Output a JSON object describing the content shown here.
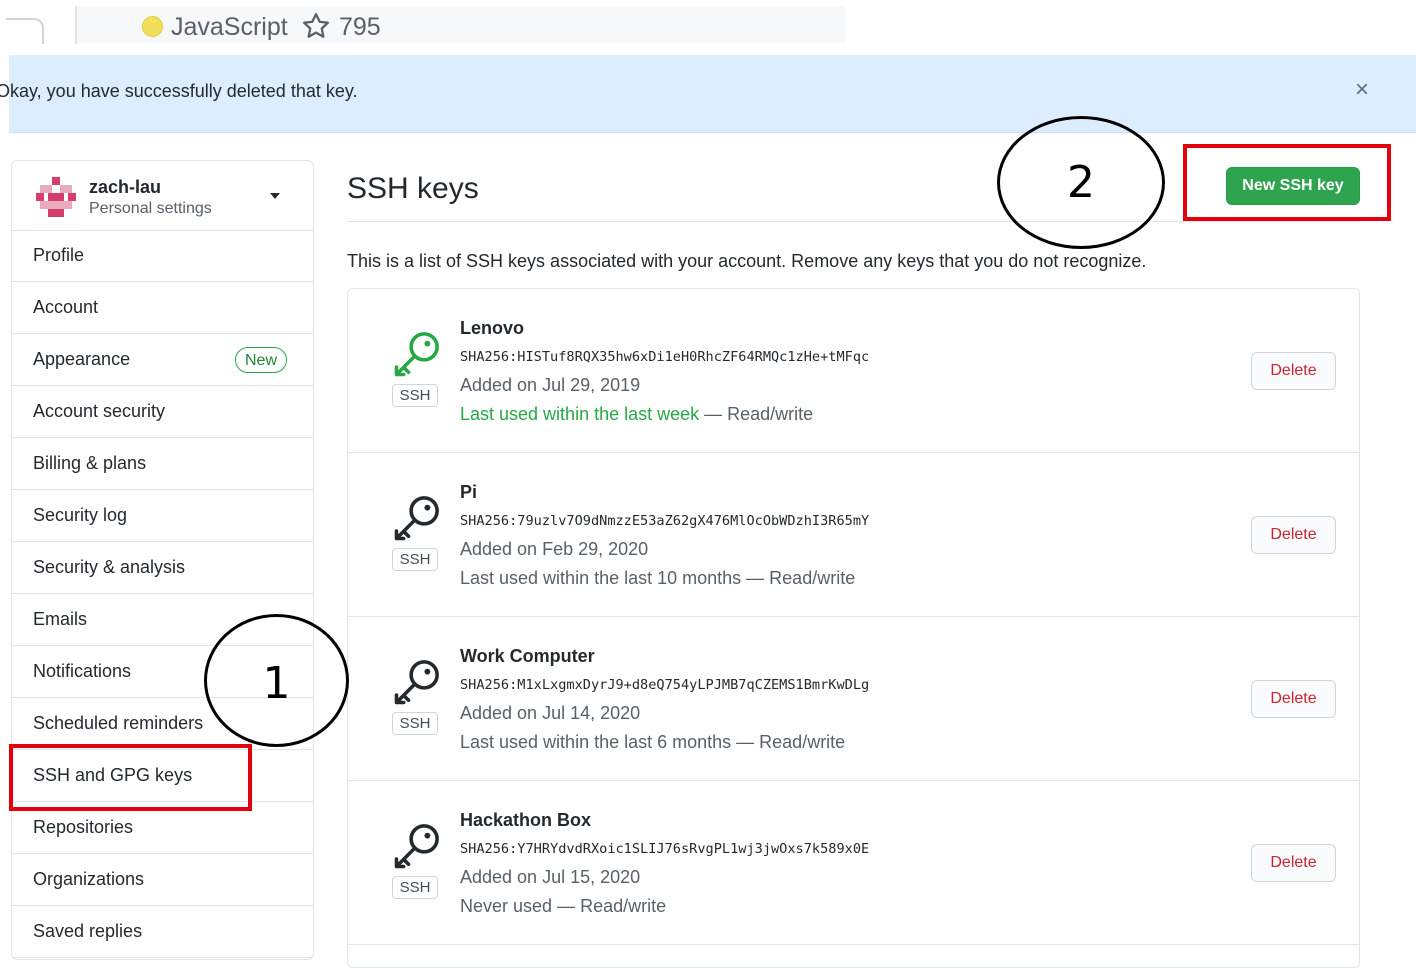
{
  "repo_strip": {
    "language": "JavaScript",
    "language_color": "#f1e05a",
    "stars": "795"
  },
  "flash": {
    "message": "Okay, you have successfully deleted that key.",
    "close": "×"
  },
  "sidebar": {
    "username": "zach-lau",
    "subtitle": "Personal settings",
    "items": [
      {
        "label": "Profile"
      },
      {
        "label": "Account"
      },
      {
        "label": "Appearance",
        "badge": "New"
      },
      {
        "label": "Account security"
      },
      {
        "label": "Billing & plans"
      },
      {
        "label": "Security log"
      },
      {
        "label": "Security & analysis"
      },
      {
        "label": "Emails"
      },
      {
        "label": "Notifications"
      },
      {
        "label": "Scheduled reminders"
      },
      {
        "label": "SSH and GPG keys"
      },
      {
        "label": "Repositories"
      },
      {
        "label": "Organizations"
      },
      {
        "label": "Saved replies"
      }
    ]
  },
  "main": {
    "title": "SSH keys",
    "new_key_label": "New SSH key",
    "description": "This is a list of SSH keys associated with your account. Remove any keys that you do not recognize.",
    "keys": [
      {
        "name": "Lenovo",
        "fingerprint": "SHA256:HISTuf8RQX35hw6xDi1eH0RhcZF64RMQc1zHe+tMFqc",
        "added": "Added on Jul 29, 2019",
        "last_used": "Last used within the last week",
        "access": " — Read/write",
        "badge": "SSH",
        "delete_label": "Delete",
        "icon_color": "#28a745"
      },
      {
        "name": "Pi",
        "fingerprint": "SHA256:79uzlv7O9dNmzzE53aZ62gX476MlOcObWDzhI3R65mY",
        "added": "Added on Feb 29, 2020",
        "last_used": "Last used within the last 10 months",
        "access": " — Read/write",
        "badge": "SSH",
        "delete_label": "Delete",
        "icon_color": "#24292e"
      },
      {
        "name": "Work Computer",
        "fingerprint": "SHA256:M1xLxgmxDyrJ9+d8eQ754yLPJMB7qCZEMS1BmrKwDLg",
        "added": "Added on Jul 14, 2020",
        "last_used": "Last used within the last 6 months",
        "access": " — Read/write",
        "badge": "SSH",
        "delete_label": "Delete",
        "icon_color": "#24292e"
      },
      {
        "name": "Hackathon Box",
        "fingerprint": "SHA256:Y7HRYdvdRXoic1SLIJ76sRvgPL1wj3jwOxs7k589x0E",
        "added": "Added on Jul 15, 2020",
        "last_used": "Never used",
        "access": " — Read/write",
        "badge": "SSH",
        "delete_label": "Delete",
        "icon_color": "#24292e"
      }
    ]
  },
  "annotations": {
    "step_one": "1",
    "step_two": "2",
    "highlight_color": "#e5000e"
  }
}
